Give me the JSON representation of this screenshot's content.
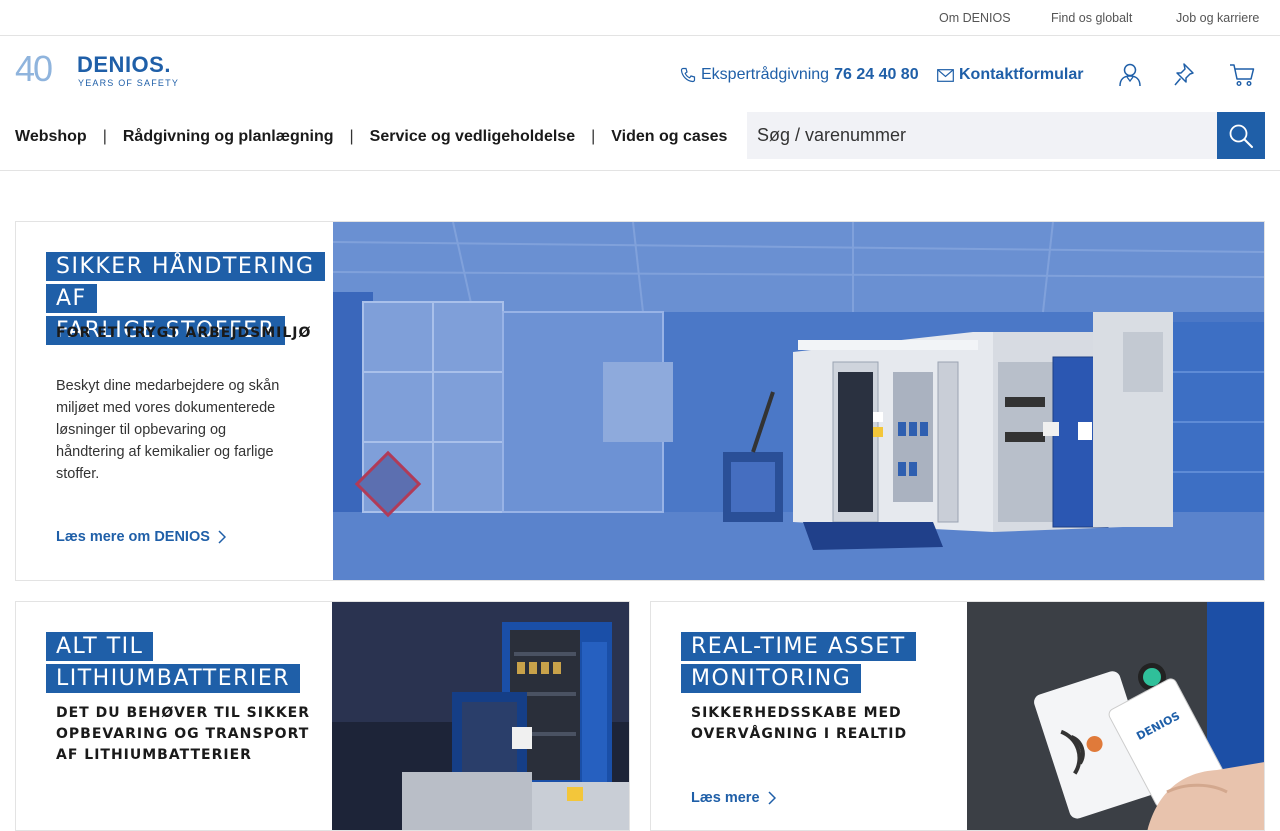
{
  "topbar": {
    "links": [
      "Om DENIOS",
      "Find os globalt",
      "Job og karriere"
    ]
  },
  "header": {
    "logo_number": "40",
    "logo_brand": "DENIOS.",
    "logo_tagline": "YEARS OF SAFETY",
    "expert_label": "Ekspertrådgivning",
    "expert_phone": "76 24 40 80",
    "contact_form": "Kontaktformular",
    "icons": [
      "user-icon",
      "pin-icon",
      "cart-icon"
    ]
  },
  "nav": {
    "items": [
      "Webshop",
      "Rådgivning og planlægning",
      "Service og vedligeholdelse",
      "Viden og cases"
    ],
    "separator": "|"
  },
  "search": {
    "placeholder": "Søg / varenummer"
  },
  "hero": {
    "title_line1": "SIKKER HÅNDTERING AF",
    "title_line2": "FARLIGE STOFFER",
    "subtitle": "FOR ET TRYGT ARBEJDSMILJØ",
    "body": "Beskyt dine medarbejdere og skån miljøet med vores dokumenterede løsninger til opbevaring og håndtering af kemikalier og farlige stoffer.",
    "link": "Læs mere om DENIOS"
  },
  "card_lithium": {
    "title_line1": "ALT TIL",
    "title_line2": "LITHIUMBATTERIER",
    "subtitle": "DET DU BEHØVER TIL SIKKER OPBEVARING OG TRANSPORT AF LITHIUMBATTERIER"
  },
  "card_monitoring": {
    "title_line1": "REAL-TIME ASSET",
    "title_line2": "MONITORING",
    "subtitle": "SIKKERHEDSSKABE MED OVERVÅGNING I REALTID",
    "link": "Læs mere",
    "card_brand": "DENIOS"
  },
  "colors": {
    "brand_blue": "#1f5fa8",
    "logo_light_blue": "#8fb4dd",
    "search_bg": "#f1f2f6",
    "border": "#e3e3e3"
  }
}
